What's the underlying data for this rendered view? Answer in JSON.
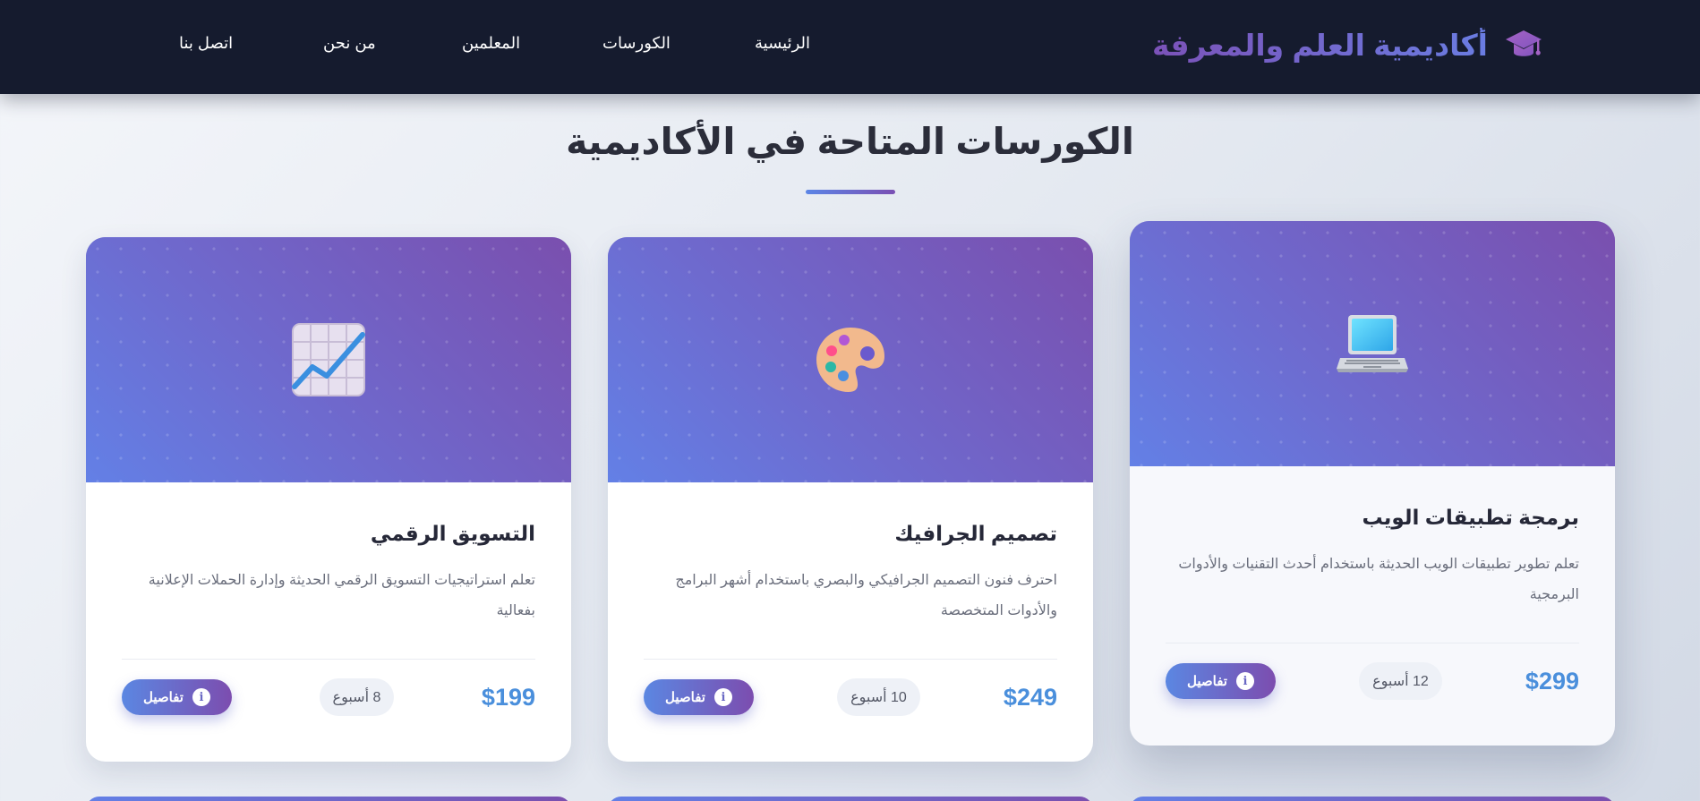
{
  "nav": {
    "brand": "أكاديمية العلم والمعرفة",
    "brand_icon": "graduation-cap-icon",
    "links": [
      "الرئيسية",
      "الكورسات",
      "المعلمين",
      "من نحن",
      "اتصل بنا"
    ]
  },
  "section": {
    "title": "الكورسات المتاحة في الأكاديمية"
  },
  "courses": [
    {
      "icon": "laptop-icon",
      "title": "برمجة تطبيقات الويب",
      "description": "تعلم تطوير تطبيقات الويب الحديثة باستخدام أحدث التقنيات والأدوات البرمجية",
      "price": "$299",
      "duration": "12 أسبوع",
      "details_label": "تفاصيل"
    },
    {
      "icon": "palette-icon",
      "title": "تصميم الجرافيك",
      "description": "احترف فنون التصميم الجرافيكي والبصري باستخدام أشهر البرامج والأدوات المتخصصة",
      "price": "$249",
      "duration": "10 أسبوع",
      "details_label": "تفاصيل"
    },
    {
      "icon": "chart-increasing-icon",
      "title": "التسويق الرقمي",
      "description": "تعلم استراتيجيات التسويق الرقمي الحديثة وإدارة الحملات الإعلانية بفعالية",
      "price": "$199",
      "duration": "8 أسبوع",
      "details_label": "تفاصيل"
    }
  ],
  "colors": {
    "nav_bg": "#151b2e",
    "accent_blue": "#4a8fdc",
    "gradient_start": "#5b87e2",
    "gradient_end": "#7c4daf"
  }
}
